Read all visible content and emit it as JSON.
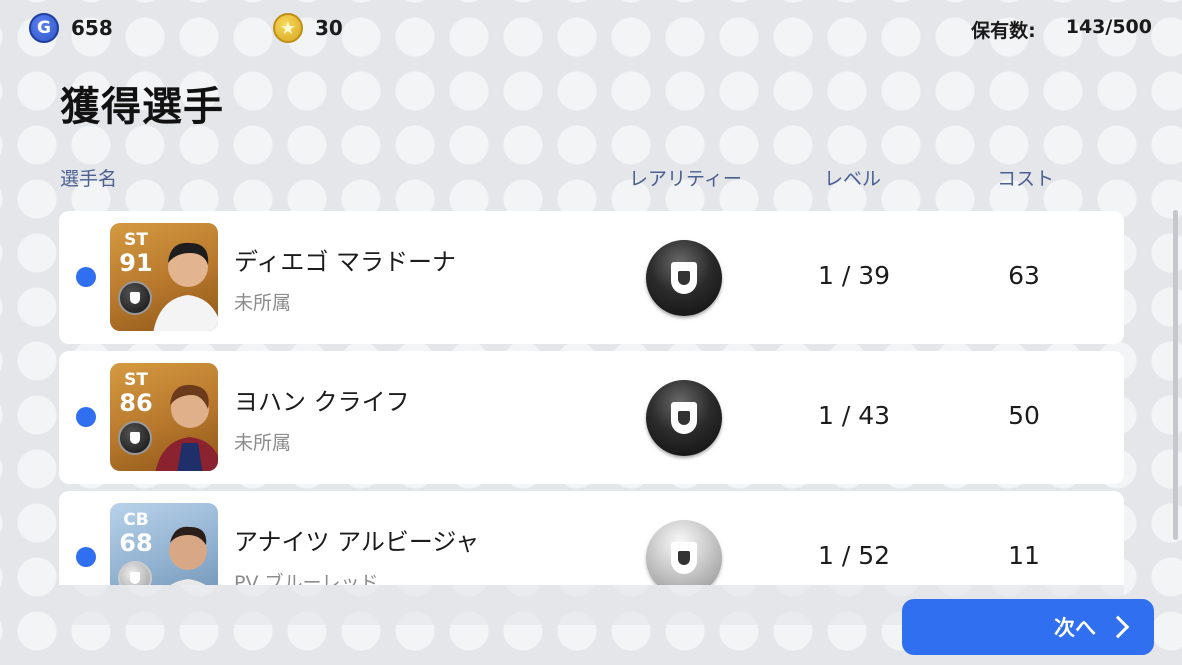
{
  "header": {
    "gp_icon": "G",
    "gp_value": "658",
    "coin_icon": "★",
    "coin_value": "30",
    "holdings_label": "保有数:",
    "holdings_value": "143/500"
  },
  "title": "獲得選手",
  "columns": {
    "name": "選手名",
    "rarity": "レアリティー",
    "level": "レベル",
    "cost": "コスト"
  },
  "players": [
    {
      "position": "ST",
      "rating": "91",
      "name": "ディエゴ マラドーナ",
      "team": "未所属",
      "rarity": "black-ball",
      "level": "1 / 39",
      "cost": "63",
      "card_color": "gold"
    },
    {
      "position": "ST",
      "rating": "86",
      "name": "ヨハン クライフ",
      "team": "未所属",
      "rarity": "black-ball",
      "level": "1 / 43",
      "cost": "50",
      "card_color": "gold"
    },
    {
      "position": "CB",
      "rating": "68",
      "name": "アナイツ アルビージャ",
      "team": "PV ブルーレッド",
      "rarity": "silver-ball",
      "level": "1 / 52",
      "cost": "11",
      "card_color": "blue"
    }
  ],
  "next_button": {
    "label": "次へ",
    "icon": "chevron-right-icon"
  },
  "colors": {
    "accent": "#2f6ff0",
    "background": "#e4e6ea"
  }
}
